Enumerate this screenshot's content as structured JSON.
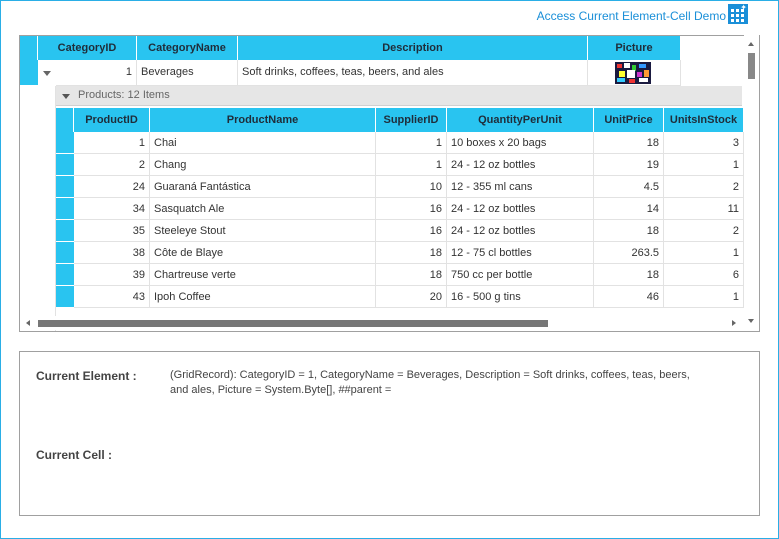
{
  "window": {
    "title": "Access Current Element-Cell Demo",
    "close_glyph": "×"
  },
  "parent_grid": {
    "columns": [
      "CategoryID",
      "CategoryName",
      "Description",
      "Picture"
    ],
    "row": {
      "CategoryID": "1",
      "CategoryName": "Beverages",
      "Description": "Soft drinks, coffees, teas, beers, and ales"
    }
  },
  "child_group": {
    "label": "Products: 12 Items"
  },
  "child_grid": {
    "columns": [
      "ProductID",
      "ProductName",
      "SupplierID",
      "QuantityPerUnit",
      "UnitPrice",
      "UnitsInStock"
    ],
    "rows": [
      {
        "ProductID": "1",
        "ProductName": "Chai",
        "SupplierID": "1",
        "QuantityPerUnit": "10 boxes x 20 bags",
        "UnitPrice": "18",
        "UnitsInStock": "3"
      },
      {
        "ProductID": "2",
        "ProductName": "Chang",
        "SupplierID": "1",
        "QuantityPerUnit": "24 - 12 oz bottles",
        "UnitPrice": "19",
        "UnitsInStock": "1"
      },
      {
        "ProductID": "24",
        "ProductName": "Guaraná Fantástica",
        "SupplierID": "10",
        "QuantityPerUnit": "12 - 355 ml cans",
        "UnitPrice": "4.5",
        "UnitsInStock": "2"
      },
      {
        "ProductID": "34",
        "ProductName": "Sasquatch Ale",
        "SupplierID": "16",
        "QuantityPerUnit": "24 - 12 oz bottles",
        "UnitPrice": "14",
        "UnitsInStock": "11"
      },
      {
        "ProductID": "35",
        "ProductName": "Steeleye Stout",
        "SupplierID": "16",
        "QuantityPerUnit": "24 - 12 oz bottles",
        "UnitPrice": "18",
        "UnitsInStock": "2"
      },
      {
        "ProductID": "38",
        "ProductName": "Côte de Blaye",
        "SupplierID": "18",
        "QuantityPerUnit": "12 - 75 cl bottles",
        "UnitPrice": "263.5",
        "UnitsInStock": "1"
      },
      {
        "ProductID": "39",
        "ProductName": "Chartreuse verte",
        "SupplierID": "18",
        "QuantityPerUnit": "750 cc per bottle",
        "UnitPrice": "18",
        "UnitsInStock": "6"
      },
      {
        "ProductID": "43",
        "ProductName": "Ipoh Coffee",
        "SupplierID": "20",
        "QuantityPerUnit": "16 - 500 g tins",
        "UnitPrice": "46",
        "UnitsInStock": "1"
      }
    ]
  },
  "info": {
    "current_element_label": "Current Element :",
    "current_element_value_line1": "(GridRecord): CategoryID = 1, CategoryName = Beverages, Description = Soft drinks, coffees, teas, beers,",
    "current_element_value_line2": "and ales, Picture = System.Byte[], ##parent =",
    "current_cell_label": "Current Cell :",
    "current_cell_value": ""
  },
  "colors": {
    "header_bg": "#29c4f0",
    "title_accent": "#1a8fd8"
  },
  "icons": {
    "window_icon": "grid-sparkle-icon",
    "close": "close-icon",
    "expand": "chevron-down-icon"
  }
}
